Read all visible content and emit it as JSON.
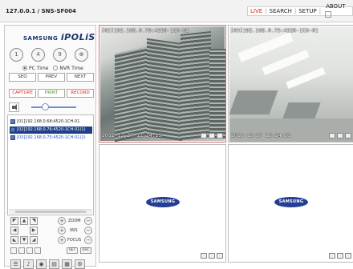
{
  "header": {
    "title": "127.0.0.1 / SNS-SF004",
    "nav": {
      "live": "LIVE",
      "search": "SEARCH",
      "setup": "SETUP",
      "about": "ABOUT"
    }
  },
  "sidebar": {
    "logo": {
      "brand": "SAMSUNG",
      "product": "iPOLiS"
    },
    "layout_buttons": [
      "1",
      "4",
      "9"
    ],
    "time_options": {
      "pc": "PC Time",
      "nvr": "NVR Time",
      "selected": "pc"
    },
    "sequence_buttons": {
      "seq": "SEQ",
      "prev": "PREV",
      "next": "NEXT"
    },
    "action_buttons": {
      "capture": "CAPTURE",
      "print": "PRINT",
      "record": "RECORD"
    },
    "volume_level": 0.3,
    "camera_list": [
      {
        "label": "[01]192.168.0.68:4520-1CH-01",
        "state": "normal"
      },
      {
        "label": "[02]192.168.0.76:4520-1CH-01(1)",
        "state": "selected"
      },
      {
        "label": "[03]192.168.0.75:4520-1CH-01(2)",
        "state": "blue"
      }
    ],
    "ptz": {
      "zoom": "ZOOM",
      "iris": "IRIS",
      "focus": "FOCUS",
      "set": "SET",
      "esc": "ESC"
    }
  },
  "viewer": {
    "cameras": [
      {
        "osd": "[02]192.168.0.76:4520-1CH-01",
        "timestamp": "2011-12-27 12:24:25",
        "active": true
      },
      {
        "osd": "[03]192.168.0.75:4520-1CH-01",
        "timestamp": "2011-12-27 12:24:23",
        "active": false
      },
      {
        "placeholder": "SAMSUNG"
      },
      {
        "placeholder": "SAMSUNG"
      }
    ]
  }
}
